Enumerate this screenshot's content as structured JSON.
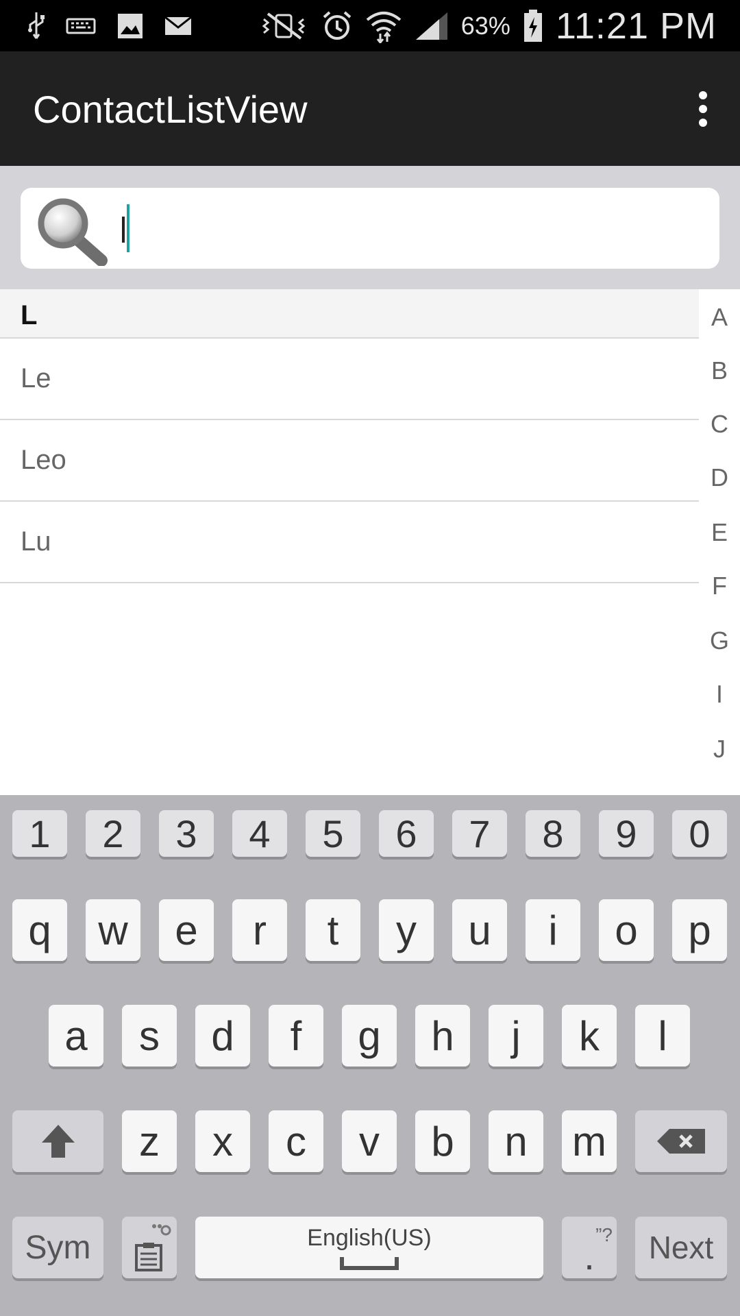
{
  "status_bar": {
    "battery_percent": "63%",
    "time": "11:21 PM"
  },
  "app_bar": {
    "title": "ContactListView"
  },
  "search": {
    "value": "",
    "placeholder": ""
  },
  "contacts": {
    "section_letter": "L",
    "items": [
      "Le",
      "Leo",
      "Lu"
    ]
  },
  "index_letters": [
    "A",
    "B",
    "C",
    "D",
    "E",
    "F",
    "G",
    "I",
    "J"
  ],
  "keyboard": {
    "number_row": [
      "1",
      "2",
      "3",
      "4",
      "5",
      "6",
      "7",
      "8",
      "9",
      "0"
    ],
    "row1": [
      "q",
      "w",
      "e",
      "r",
      "t",
      "y",
      "u",
      "i",
      "o",
      "p"
    ],
    "row2": [
      "a",
      "s",
      "d",
      "f",
      "g",
      "h",
      "j",
      "k",
      "l"
    ],
    "row3": [
      "z",
      "x",
      "c",
      "v",
      "b",
      "n",
      "m"
    ],
    "sym_label": "Sym",
    "space_label": "English(US)",
    "period_label": ".",
    "period_hint": "”?",
    "next_label": "Next"
  }
}
